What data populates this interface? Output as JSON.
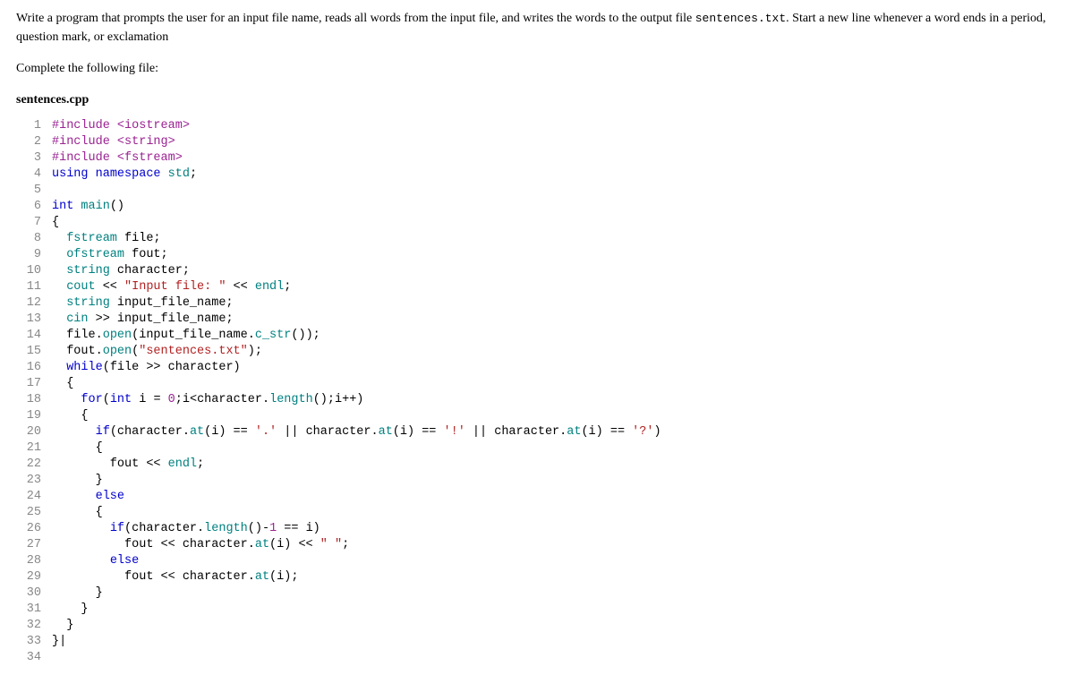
{
  "question": {
    "part1": "Write a program that prompts the user for an input file name, reads all words from the input file, and writes the words to the output file ",
    "codefile": "sentences.txt",
    "part2": ". Start a new line whenever a word ends in a period, question mark, or exclamation"
  },
  "complete_text": "Complete the following file:",
  "filename": "sentences.cpp",
  "code": {
    "line_count": 34,
    "lines": [
      {
        "n": 1,
        "tokens": [
          {
            "t": "#include <iostream>",
            "c": "kw-preproc"
          }
        ]
      },
      {
        "n": 2,
        "tokens": [
          {
            "t": "#include <string>",
            "c": "kw-preproc"
          }
        ]
      },
      {
        "n": 3,
        "tokens": [
          {
            "t": "#include <fstream>",
            "c": "kw-preproc"
          }
        ]
      },
      {
        "n": 4,
        "tokens": [
          {
            "t": "using",
            "c": "kw-blue"
          },
          {
            "t": " ",
            "c": ""
          },
          {
            "t": "namespace",
            "c": "kw-blue"
          },
          {
            "t": " ",
            "c": ""
          },
          {
            "t": "std",
            "c": "kw-teal"
          },
          {
            "t": ";",
            "c": ""
          }
        ]
      },
      {
        "n": 5,
        "tokens": [
          {
            "t": "",
            "c": ""
          }
        ]
      },
      {
        "n": 6,
        "tokens": [
          {
            "t": "int",
            "c": "kw-blue"
          },
          {
            "t": " ",
            "c": ""
          },
          {
            "t": "main",
            "c": "kw-teal"
          },
          {
            "t": "()",
            "c": ""
          }
        ]
      },
      {
        "n": 7,
        "tokens": [
          {
            "t": "{",
            "c": ""
          }
        ]
      },
      {
        "n": 8,
        "tokens": [
          {
            "t": "  ",
            "c": ""
          },
          {
            "t": "fstream",
            "c": "kw-teal"
          },
          {
            "t": " file;",
            "c": ""
          }
        ]
      },
      {
        "n": 9,
        "tokens": [
          {
            "t": "  ",
            "c": ""
          },
          {
            "t": "ofstream",
            "c": "kw-teal"
          },
          {
            "t": " fout;",
            "c": ""
          }
        ]
      },
      {
        "n": 10,
        "tokens": [
          {
            "t": "  ",
            "c": ""
          },
          {
            "t": "string",
            "c": "kw-teal"
          },
          {
            "t": " character;",
            "c": ""
          }
        ]
      },
      {
        "n": 11,
        "tokens": [
          {
            "t": "  ",
            "c": ""
          },
          {
            "t": "cout",
            "c": "kw-teal"
          },
          {
            "t": " << ",
            "c": ""
          },
          {
            "t": "\"Input file: \"",
            "c": "kw-string"
          },
          {
            "t": " << ",
            "c": ""
          },
          {
            "t": "endl",
            "c": "kw-teal"
          },
          {
            "t": ";",
            "c": ""
          }
        ]
      },
      {
        "n": 12,
        "tokens": [
          {
            "t": "  ",
            "c": ""
          },
          {
            "t": "string",
            "c": "kw-teal"
          },
          {
            "t": " input_file_name;",
            "c": ""
          }
        ]
      },
      {
        "n": 13,
        "tokens": [
          {
            "t": "  ",
            "c": ""
          },
          {
            "t": "cin",
            "c": "kw-teal"
          },
          {
            "t": " >> input_file_name;",
            "c": ""
          }
        ]
      },
      {
        "n": 14,
        "tokens": [
          {
            "t": "  file.",
            "c": ""
          },
          {
            "t": "open",
            "c": "kw-teal"
          },
          {
            "t": "(input_file_name.",
            "c": ""
          },
          {
            "t": "c_str",
            "c": "kw-teal"
          },
          {
            "t": "());",
            "c": ""
          }
        ]
      },
      {
        "n": 15,
        "tokens": [
          {
            "t": "  fout.",
            "c": ""
          },
          {
            "t": "open",
            "c": "kw-teal"
          },
          {
            "t": "(",
            "c": ""
          },
          {
            "t": "\"sentences.txt\"",
            "c": "kw-string"
          },
          {
            "t": ");",
            "c": ""
          }
        ]
      },
      {
        "n": 16,
        "tokens": [
          {
            "t": "  ",
            "c": ""
          },
          {
            "t": "while",
            "c": "kw-blue"
          },
          {
            "t": "(file >> character)",
            "c": ""
          }
        ]
      },
      {
        "n": 17,
        "tokens": [
          {
            "t": "  {",
            "c": ""
          }
        ]
      },
      {
        "n": 18,
        "tokens": [
          {
            "t": "    ",
            "c": ""
          },
          {
            "t": "for",
            "c": "kw-blue"
          },
          {
            "t": "(",
            "c": ""
          },
          {
            "t": "int",
            "c": "kw-blue"
          },
          {
            "t": " i = ",
            "c": ""
          },
          {
            "t": "0",
            "c": "kw-num"
          },
          {
            "t": ";i<character.",
            "c": ""
          },
          {
            "t": "length",
            "c": "kw-teal"
          },
          {
            "t": "();i++)",
            "c": ""
          }
        ]
      },
      {
        "n": 19,
        "tokens": [
          {
            "t": "    {",
            "c": ""
          }
        ]
      },
      {
        "n": 20,
        "tokens": [
          {
            "t": "      ",
            "c": ""
          },
          {
            "t": "if",
            "c": "kw-blue"
          },
          {
            "t": "(character.",
            "c": ""
          },
          {
            "t": "at",
            "c": "kw-teal"
          },
          {
            "t": "(i) == ",
            "c": ""
          },
          {
            "t": "'.'",
            "c": "kw-char"
          },
          {
            "t": " || character.",
            "c": ""
          },
          {
            "t": "at",
            "c": "kw-teal"
          },
          {
            "t": "(i) == ",
            "c": ""
          },
          {
            "t": "'!'",
            "c": "kw-char"
          },
          {
            "t": " || character.",
            "c": ""
          },
          {
            "t": "at",
            "c": "kw-teal"
          },
          {
            "t": "(i) == ",
            "c": ""
          },
          {
            "t": "'?'",
            "c": "kw-char"
          },
          {
            "t": ")",
            "c": ""
          }
        ]
      },
      {
        "n": 21,
        "tokens": [
          {
            "t": "      {",
            "c": ""
          }
        ]
      },
      {
        "n": 22,
        "tokens": [
          {
            "t": "        fout << ",
            "c": ""
          },
          {
            "t": "endl",
            "c": "kw-teal"
          },
          {
            "t": ";",
            "c": ""
          }
        ]
      },
      {
        "n": 23,
        "tokens": [
          {
            "t": "      }",
            "c": ""
          }
        ]
      },
      {
        "n": 24,
        "tokens": [
          {
            "t": "      ",
            "c": ""
          },
          {
            "t": "else",
            "c": "kw-blue"
          }
        ]
      },
      {
        "n": 25,
        "tokens": [
          {
            "t": "      {",
            "c": ""
          }
        ]
      },
      {
        "n": 26,
        "tokens": [
          {
            "t": "        ",
            "c": ""
          },
          {
            "t": "if",
            "c": "kw-blue"
          },
          {
            "t": "(character.",
            "c": ""
          },
          {
            "t": "length",
            "c": "kw-teal"
          },
          {
            "t": "()-",
            "c": ""
          },
          {
            "t": "1",
            "c": "kw-num"
          },
          {
            "t": " == i)",
            "c": ""
          }
        ]
      },
      {
        "n": 27,
        "tokens": [
          {
            "t": "          fout << character.",
            "c": ""
          },
          {
            "t": "at",
            "c": "kw-teal"
          },
          {
            "t": "(i) << ",
            "c": ""
          },
          {
            "t": "\" \"",
            "c": "kw-string"
          },
          {
            "t": ";",
            "c": ""
          }
        ]
      },
      {
        "n": 28,
        "tokens": [
          {
            "t": "        ",
            "c": ""
          },
          {
            "t": "else",
            "c": "kw-blue"
          }
        ]
      },
      {
        "n": 29,
        "tokens": [
          {
            "t": "          fout << character.",
            "c": ""
          },
          {
            "t": "at",
            "c": "kw-teal"
          },
          {
            "t": "(i);",
            "c": ""
          }
        ]
      },
      {
        "n": 30,
        "tokens": [
          {
            "t": "      }",
            "c": ""
          }
        ]
      },
      {
        "n": 31,
        "tokens": [
          {
            "t": "    }",
            "c": ""
          }
        ]
      },
      {
        "n": 32,
        "tokens": [
          {
            "t": "  }",
            "c": ""
          }
        ]
      },
      {
        "n": 33,
        "tokens": [
          {
            "t": "}|",
            "c": ""
          }
        ]
      },
      {
        "n": 34,
        "tokens": [
          {
            "t": "",
            "c": ""
          }
        ]
      }
    ]
  }
}
